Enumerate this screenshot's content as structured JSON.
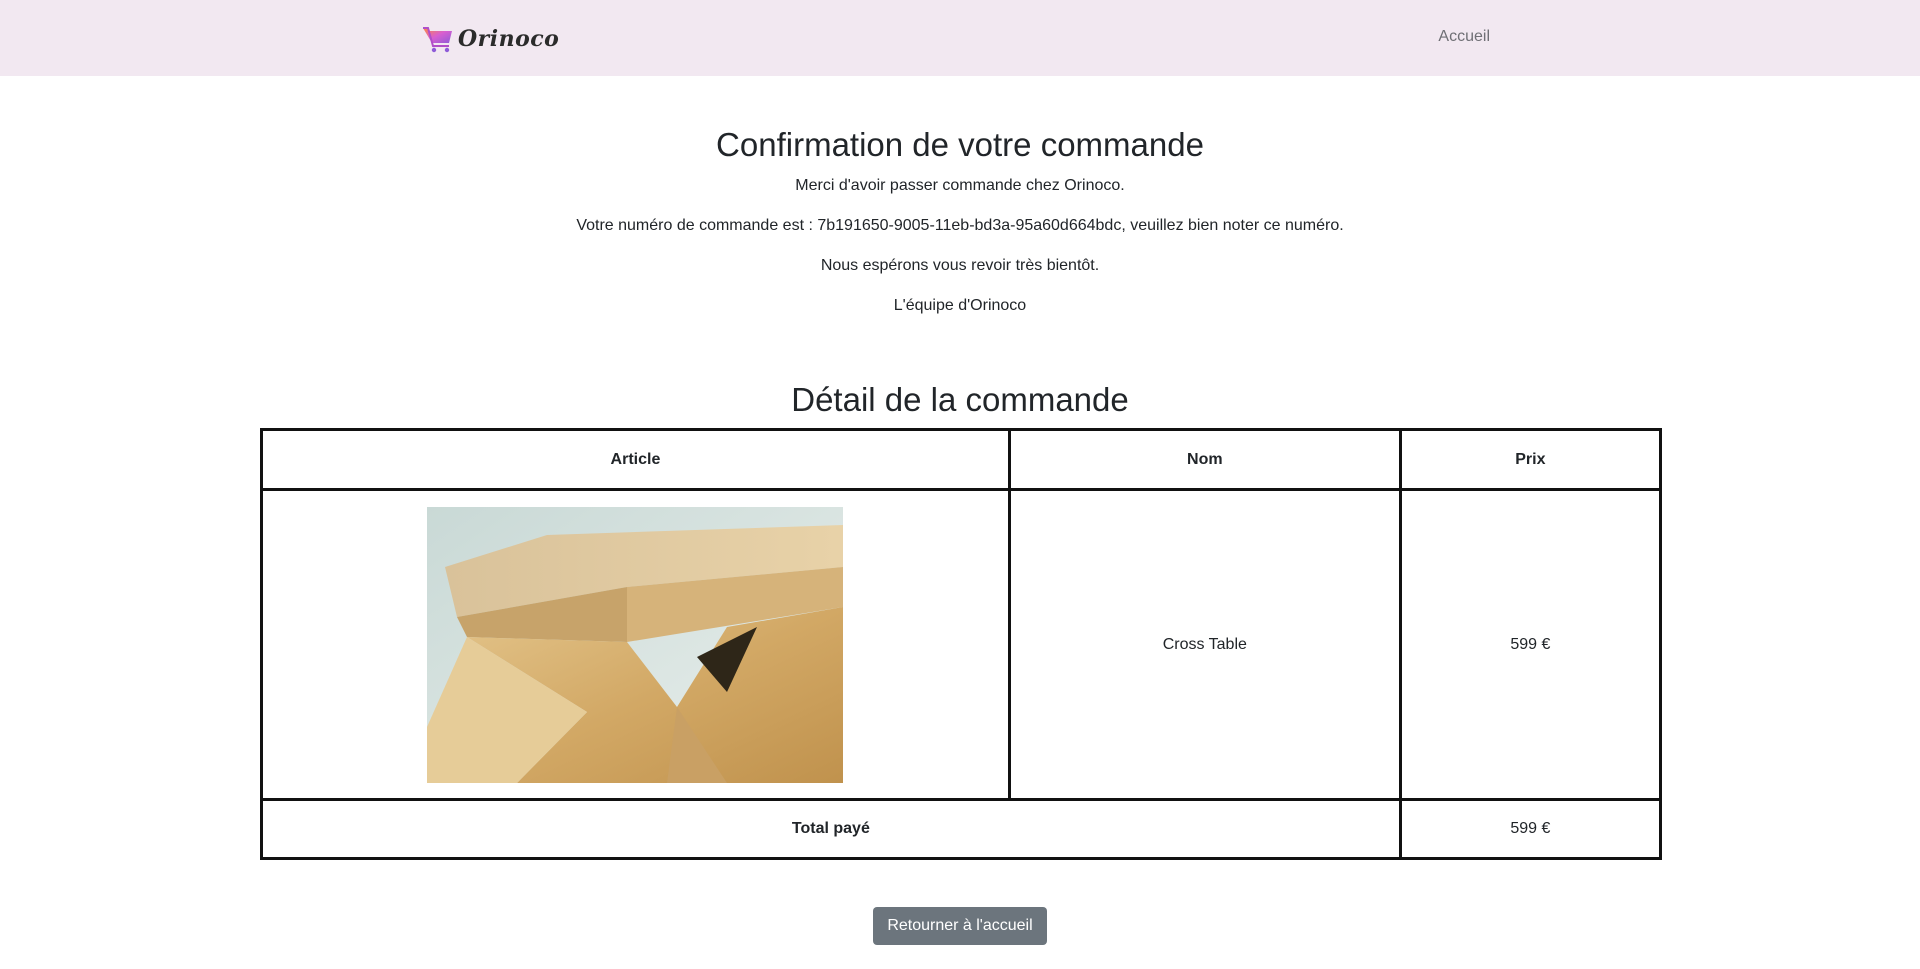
{
  "navbar": {
    "brand_name": "Orinoco",
    "brand_icon": "shopping-cart-icon",
    "home_link": "Accueil",
    "background": "#f2e8f1"
  },
  "confirmation": {
    "title": "Confirmation de votre commande",
    "thanks": "Merci d'avoir passer commande chez Orinoco.",
    "order_number_text": "Votre numéro de commande est : 7b191650-9005-11eb-bd3a-95a60d664bdc, veuillez bien noter ce numéro.",
    "see_you": "Nous espérons vous revoir très bientôt.",
    "signature": "L'équipe d'Orinoco"
  },
  "order_detail": {
    "title": "Détail de la commande",
    "columns": [
      "Article",
      "Nom",
      "Prix"
    ],
    "items": [
      {
        "image": "wooden-cross-table-photo",
        "name": "Cross Table",
        "price": "599 €"
      }
    ],
    "total_label": "Total payé",
    "total_value": "599 €"
  },
  "actions": {
    "back_home_label": "Retourner à l'accueil",
    "button_color": "#6c757d"
  }
}
